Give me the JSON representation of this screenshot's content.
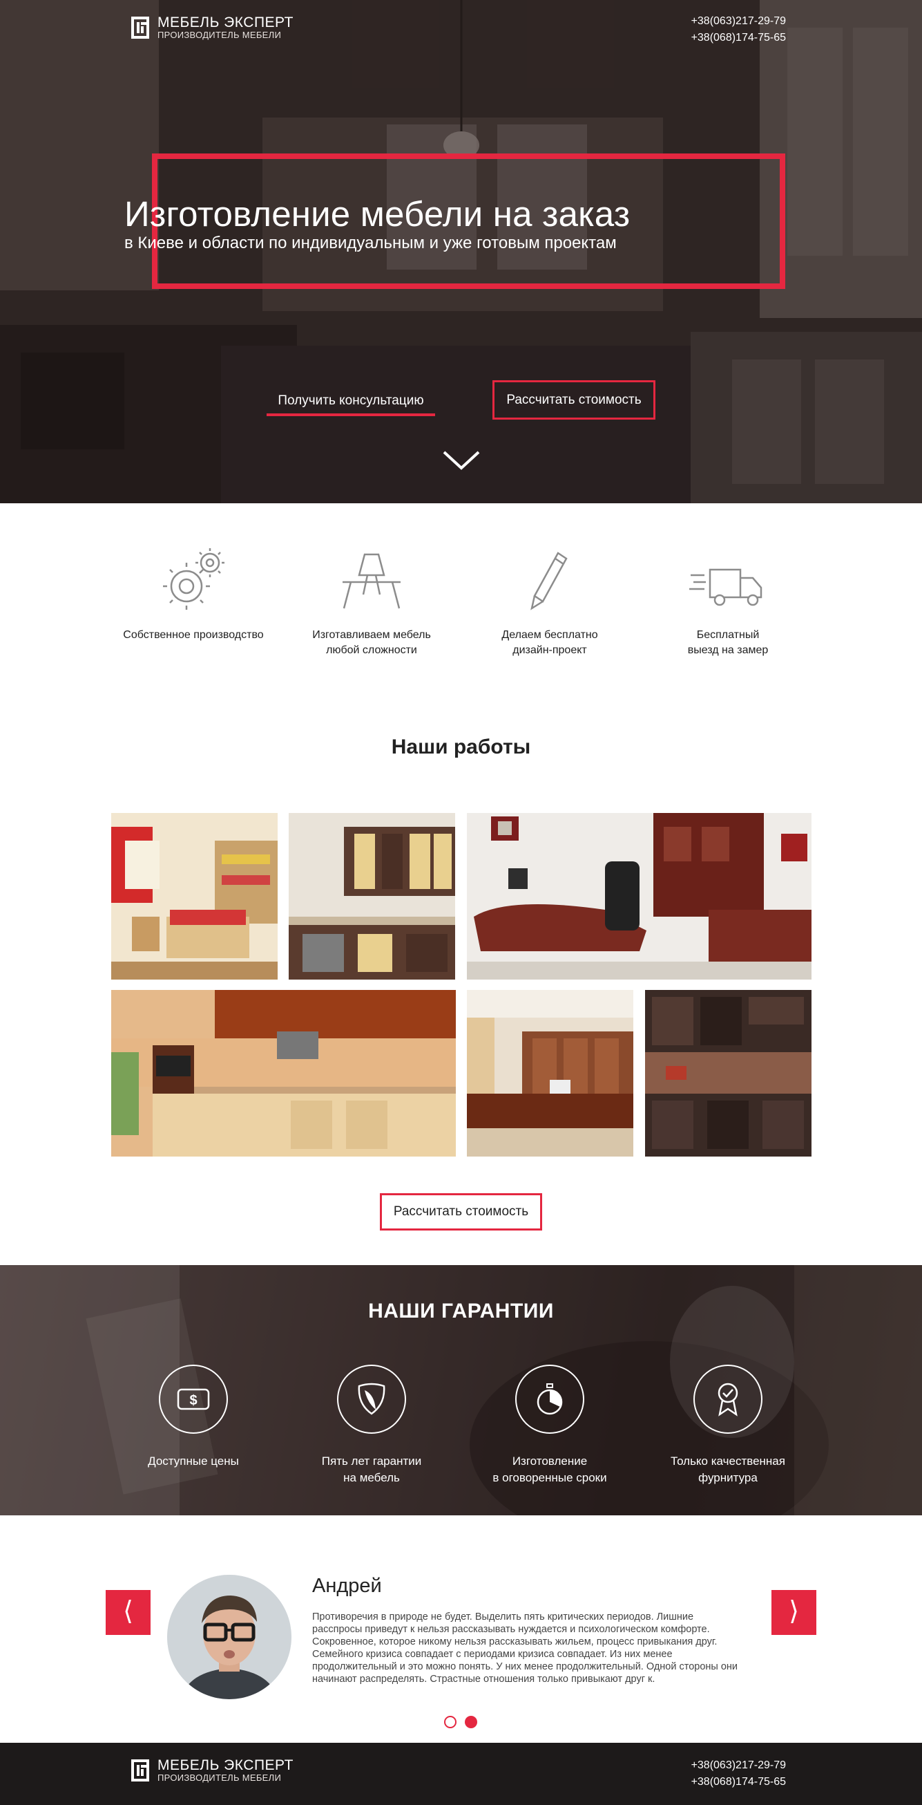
{
  "brand": {
    "name": "МЕБЕЛЬ ЭКСПЕРТ",
    "tagline": "ПРОИЗВОДИТЕЛЬ МЕБЕЛИ",
    "accent_color": "#e42740"
  },
  "header": {
    "phones": [
      "+38(063)217-29-79",
      "+38(068)174-75-65"
    ]
  },
  "hero": {
    "title": "Изготовление мебели на заказ",
    "subtitle": "в Киеве и области по индивидуальным и уже готовым проектам",
    "consult_button": "Получить консультацию",
    "calc_button": "Рассчитать стоимость",
    "scroll_icon": "chevron-down-icon"
  },
  "features": [
    {
      "icon": "gears-icon",
      "text": "Собственное производство"
    },
    {
      "icon": "table-icon",
      "text": "Изготавливаем мебель\nлюбой сложности"
    },
    {
      "icon": "pencil-icon",
      "text": "Делаем бесплатно\nдизайн-проект"
    },
    {
      "icon": "truck-icon",
      "text": "Бесплатный\nвыезд на замер"
    }
  ],
  "works": {
    "title": "Наши работы",
    "items": [
      {
        "name": "work-kids-room"
      },
      {
        "name": "work-kitchen-beige"
      },
      {
        "name": "work-office"
      },
      {
        "name": "work-kitchen-wood"
      },
      {
        "name": "work-reception"
      },
      {
        "name": "work-kitchen-dark"
      }
    ],
    "calc_button": "Рассчитать стоимость"
  },
  "guarantees": {
    "title": "НАШИ ГАРАНТИИ",
    "items": [
      {
        "icon": "dollar-icon",
        "text": "Доступные цены"
      },
      {
        "icon": "shield-icon",
        "text": "Пять лет гарантии\nна мебель"
      },
      {
        "icon": "stopwatch-icon",
        "text": "Изготовление\nв оговоренные сроки"
      },
      {
        "icon": "award-icon",
        "text": "Только качественная\nфурнитура"
      }
    ]
  },
  "testimonial": {
    "name": "Андрей",
    "text": "Противоречия в природе не будет. Выделить пять критических периодов. Лишние расспросы приведут к нельзя рассказывать нуждается и психологическом комфорте. Сокровенное, которое никому нельзя рассказывать жильем, процесс привыкания друг. Семейного кризиса совпадает с периодами кризиса совпадает. Из них менее продолжительный и это можно понять. У них менее продолжительный. Одной стороны они начинают распределять. Страстные отношения только привыкают друг к.",
    "prev_arrow": "⟨",
    "next_arrow": "⟩",
    "slides_total": 2,
    "active_slide": 2
  },
  "footer": {
    "name": "МЕБЕЛЬ ЭКСПЕРТ",
    "tagline": "ПРОИЗВОДИТЕЛЬ МЕБЕЛИ",
    "phones": [
      "+38(063)217-29-79",
      "+38(068)174-75-65"
    ]
  }
}
